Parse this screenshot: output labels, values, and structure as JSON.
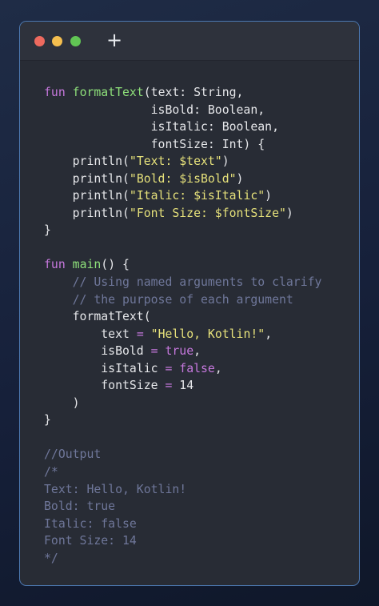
{
  "window": {
    "new_tab_label": "+"
  },
  "code_lines": [
    [
      {
        "t": "fun",
        "c": "kw"
      },
      {
        "t": " "
      },
      {
        "t": "formatText",
        "c": "fn"
      },
      {
        "t": "(text: String,"
      }
    ],
    [
      {
        "t": "               isBold: Boolean,"
      }
    ],
    [
      {
        "t": "               isItalic: Boolean,"
      }
    ],
    [
      {
        "t": "               fontSize: Int) {"
      }
    ],
    [
      {
        "t": "    println("
      },
      {
        "t": "\"Text: $text\"",
        "c": "str"
      },
      {
        "t": ")"
      }
    ],
    [
      {
        "t": "    println("
      },
      {
        "t": "\"Bold: $isBold\"",
        "c": "str"
      },
      {
        "t": ")"
      }
    ],
    [
      {
        "t": "    println("
      },
      {
        "t": "\"Italic: $isItalic\"",
        "c": "str"
      },
      {
        "t": ")"
      }
    ],
    [
      {
        "t": "    println("
      },
      {
        "t": "\"Font Size: $fontSize\"",
        "c": "str"
      },
      {
        "t": ")"
      }
    ],
    [
      {
        "t": "}"
      }
    ],
    [],
    [
      {
        "t": "fun",
        "c": "kw"
      },
      {
        "t": " "
      },
      {
        "t": "main",
        "c": "fn"
      },
      {
        "t": "() {"
      }
    ],
    [
      {
        "t": "    "
      },
      {
        "t": "// Using named arguments to clarify",
        "c": "cm"
      }
    ],
    [
      {
        "t": "    "
      },
      {
        "t": "// the purpose of each argument",
        "c": "cm"
      }
    ],
    [
      {
        "t": "    formatText("
      }
    ],
    [
      {
        "t": "        text "
      },
      {
        "t": "=",
        "c": "op"
      },
      {
        "t": " "
      },
      {
        "t": "\"Hello, Kotlin!\"",
        "c": "str"
      },
      {
        "t": ","
      }
    ],
    [
      {
        "t": "        isBold "
      },
      {
        "t": "=",
        "c": "op"
      },
      {
        "t": " "
      },
      {
        "t": "true",
        "c": "bool"
      },
      {
        "t": ","
      }
    ],
    [
      {
        "t": "        isItalic "
      },
      {
        "t": "=",
        "c": "op"
      },
      {
        "t": " "
      },
      {
        "t": "false",
        "c": "bool"
      },
      {
        "t": ","
      }
    ],
    [
      {
        "t": "        fontSize "
      },
      {
        "t": "=",
        "c": "op"
      },
      {
        "t": " 14"
      }
    ],
    [
      {
        "t": "    )"
      }
    ],
    [
      {
        "t": "}"
      }
    ],
    [],
    [
      {
        "t": "//Output",
        "c": "cm"
      }
    ],
    [
      {
        "t": "/*",
        "c": "cm"
      }
    ],
    [
      {
        "t": "Text: Hello, Kotlin!",
        "c": "cm"
      }
    ],
    [
      {
        "t": "Bold: true",
        "c": "cm"
      }
    ],
    [
      {
        "t": "Italic: false",
        "c": "cm"
      }
    ],
    [
      {
        "t": "Font Size: 14",
        "c": "cm"
      }
    ],
    [
      {
        "t": "*/",
        "c": "cm"
      }
    ]
  ],
  "colors": {
    "keyword": "#c678dd",
    "function": "#8ee07a",
    "string": "#e5e07a",
    "comment": "#6f779a",
    "text": "#e6e7ea",
    "window_border": "#4c78b0"
  }
}
